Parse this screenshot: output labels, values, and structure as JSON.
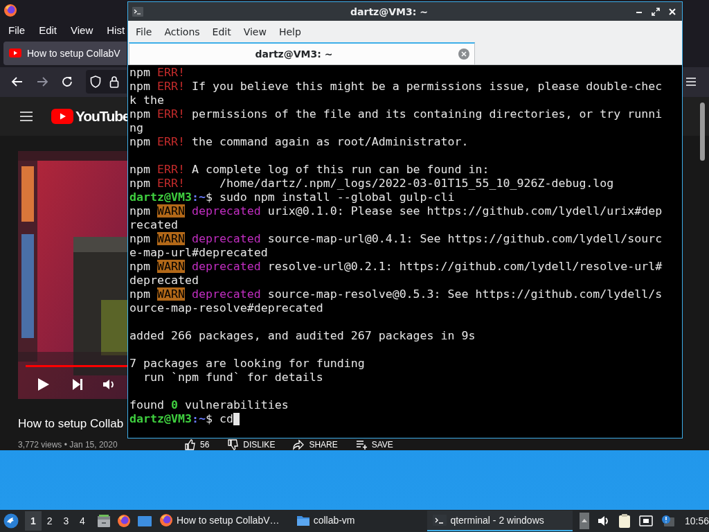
{
  "browser": {
    "menu": [
      "File",
      "Edit",
      "View",
      "Hist"
    ],
    "tab": {
      "title": "How to setup CollabV",
      "selected": true
    },
    "logo_text": "YouTube",
    "video": {
      "kind": "picture"
    },
    "video_title": "How to setup Collab",
    "video_meta": "3,772 views • Jan 15, 2020",
    "actions": [
      {
        "kind": "like",
        "label": "56"
      },
      {
        "kind": "dislike",
        "label": "DISLIKE"
      },
      {
        "kind": "share",
        "label": "SHARE"
      },
      {
        "kind": "save",
        "label": "SAVE"
      }
    ]
  },
  "terminal": {
    "title": "dartz@VM3: ~",
    "menu": [
      "File",
      "Actions",
      "Edit",
      "View",
      "Help"
    ],
    "tabs": [
      {
        "title": "dartz@VM3: ~",
        "selected": true
      }
    ],
    "lines": [
      {
        "gap_before": false,
        "segments": [
          {
            "text": "npm "
          },
          {
            "text": "ERR!",
            "kind": "err"
          }
        ]
      },
      {
        "segments": [
          {
            "text": "npm "
          },
          {
            "text": "ERR!",
            "kind": "err"
          },
          {
            "text": " If you believe this might be a permissions issue, please double-chec"
          }
        ]
      },
      {
        "segments": [
          {
            "text": "k the"
          }
        ]
      },
      {
        "segments": [
          {
            "text": "npm "
          },
          {
            "text": "ERR!",
            "kind": "err"
          },
          {
            "text": " permissions of the file and its containing directories, or try runni"
          }
        ]
      },
      {
        "segments": [
          {
            "text": "ng"
          }
        ]
      },
      {
        "segments": [
          {
            "text": "npm "
          },
          {
            "text": "ERR!",
            "kind": "err"
          },
          {
            "text": " the command again as root/Administrator."
          }
        ]
      },
      {
        "gap_before": true,
        "segments": [
          {
            "text": "npm "
          },
          {
            "text": "ERR!",
            "kind": "err"
          },
          {
            "text": " A complete log of this run can be found in:"
          }
        ]
      },
      {
        "segments": [
          {
            "text": "npm "
          },
          {
            "text": "ERR!",
            "kind": "err"
          },
          {
            "text": "     /home/dartz/.npm/_logs/2022-03-01T15_55_10_926Z-debug.log"
          }
        ]
      },
      {
        "segments": [
          {
            "text": "dartz@VM3",
            "kind": "user"
          },
          {
            "text": ":~",
            "kind": "path"
          },
          {
            "text": "$ sudo npm install --global gulp-cli"
          }
        ]
      },
      {
        "segments": [
          {
            "text": "npm "
          },
          {
            "text": "WARN",
            "kind": "warn"
          },
          {
            "text": "deprecated",
            "kind": "deprecated"
          },
          {
            "text": " urix@0.1.0: Please see https://github.com/lydell/urix#dep"
          }
        ]
      },
      {
        "segments": [
          {
            "text": "recated"
          }
        ]
      },
      {
        "segments": [
          {
            "text": "npm "
          },
          {
            "text": "WARN",
            "kind": "warn"
          },
          {
            "text": "deprecated",
            "kind": "deprecated"
          },
          {
            "text": " source-map-url@0.4.1: See https://github.com/lydell/sourc"
          }
        ]
      },
      {
        "segments": [
          {
            "text": "e-map-url#deprecated"
          }
        ]
      },
      {
        "segments": [
          {
            "text": "npm "
          },
          {
            "text": "WARN",
            "kind": "warn"
          },
          {
            "text": "deprecated",
            "kind": "deprecated"
          },
          {
            "text": " resolve-url@0.2.1: https://github.com/lydell/resolve-url#"
          }
        ]
      },
      {
        "segments": [
          {
            "text": "deprecated"
          }
        ]
      },
      {
        "segments": [
          {
            "text": "npm "
          },
          {
            "text": "WARN",
            "kind": "warn"
          },
          {
            "text": "deprecated",
            "kind": "deprecated"
          },
          {
            "text": " source-map-resolve@0.5.3: See https://github.com/lydell/s"
          }
        ]
      },
      {
        "segments": [
          {
            "text": "ource-map-resolve#deprecated"
          }
        ]
      },
      {
        "gap_before": true,
        "segments": [
          {
            "text": "added 266 packages, and audited 267 packages in 9s"
          }
        ]
      },
      {
        "gap_before": true,
        "segments": [
          {
            "text": "7 packages are looking for funding"
          }
        ]
      },
      {
        "segments": [
          {
            "text": "  run `npm fund` for details"
          }
        ]
      },
      {
        "gap_before": true,
        "segments": [
          {
            "text": "found "
          },
          {
            "text": "0",
            "kind": "number"
          },
          {
            "text": " vulnerabilities"
          }
        ]
      },
      {
        "segments": [
          {
            "text": "dartz@VM3",
            "kind": "user"
          },
          {
            "text": ":~",
            "kind": "path"
          },
          {
            "text": "$ cd"
          }
        ],
        "cursor": true
      }
    ]
  },
  "taskbar": {
    "workspaces": [
      {
        "label": "1",
        "selected": true
      },
      {
        "label": "2",
        "selected": false
      },
      {
        "label": "3",
        "selected": false
      },
      {
        "label": "4",
        "selected": false
      }
    ],
    "tasks": [
      {
        "kind": "firefox",
        "label": "How to setup CollabV…",
        "selected": false
      },
      {
        "kind": "folder",
        "label": "collab-vm",
        "selected": false
      },
      {
        "kind": "terminal",
        "label": "qterminal - 2 windows",
        "selected": true
      }
    ],
    "clock": "10:56"
  }
}
